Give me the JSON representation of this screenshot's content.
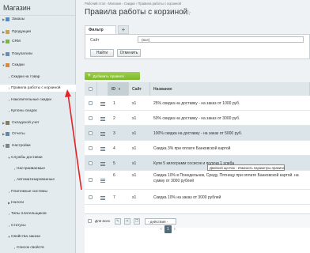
{
  "sidebar": {
    "title": "Магазин",
    "items": [
      {
        "label": "Заказы",
        "arrow": "▶",
        "icon_color": "#4f8bc9",
        "active": false
      },
      {
        "label": "Продукция",
        "arrow": "▶",
        "icon_color": "#c9a24f",
        "active": false
      },
      {
        "label": "CRM",
        "arrow": "▶",
        "icon_color": "#7ab34a",
        "active": false
      },
      {
        "label": "Покупатели",
        "arrow": "▶",
        "icon_color": "#6a8bb5",
        "active": false
      },
      {
        "label": "Скидки",
        "arrow": "▼",
        "icon_color": "#d58a3c",
        "active": false
      },
      {
        "label": "Скидки на товар",
        "arrow": "",
        "icon_color": "",
        "active": false
      },
      {
        "label": "Правила работы с корзиной",
        "arrow": "",
        "icon_color": "",
        "active": true
      },
      {
        "label": "Накопительные скидки",
        "arrow": "",
        "icon_color": "",
        "active": false
      },
      {
        "label": "Купоны скидок",
        "arrow": "",
        "icon_color": "",
        "active": false
      },
      {
        "label": "Складской учет",
        "arrow": "▶",
        "icon_color": "#8a7a5a",
        "active": false
      },
      {
        "label": "Отчеты",
        "arrow": "▶",
        "icon_color": "#5a8ab5",
        "active": false
      },
      {
        "label": "Настройки",
        "arrow": "▼",
        "icon_color": "#7a868c",
        "active": false
      },
      {
        "label": "Службы доставки",
        "arrow": "▼",
        "icon_color": "",
        "active": false
      },
      {
        "label": "Настраиваемые",
        "arrow": "",
        "icon_color": "",
        "active": false
      },
      {
        "label": "Автоматизированные",
        "arrow": "",
        "icon_color": "",
        "active": false
      },
      {
        "label": "Платежные системы",
        "arrow": "",
        "icon_color": "",
        "active": false
      },
      {
        "label": "Налоги",
        "arrow": "▶",
        "icon_color": "",
        "active": false
      },
      {
        "label": "Типы плательщиков",
        "arrow": "",
        "icon_color": "",
        "active": false
      },
      {
        "label": "Статусы",
        "arrow": "",
        "icon_color": "",
        "active": false
      },
      {
        "label": "Свойства заказа",
        "arrow": "▼",
        "icon_color": "",
        "active": false
      },
      {
        "label": "Список свойств",
        "arrow": "",
        "icon_color": "",
        "active": false
      }
    ]
  },
  "breadcrumbs": "Рабочий стол  ›  Магазин  ›  Скидки  ›  Правила работы с корзиной",
  "page_title": "Правила работы с корзиной",
  "star": "☆",
  "filter": {
    "tab_label": "Фильтр",
    "add_tab": "+",
    "site_label": "Сайт",
    "site_value": "(все)",
    "find_button": "Найти",
    "cancel_button": "Отменить"
  },
  "add_button": "Добавить правило",
  "table": {
    "headers": {
      "id": "ID",
      "site": "Сайт",
      "name": "Название"
    },
    "rows": [
      {
        "id": "1",
        "site": "s1",
        "name": "25% скидка на доставку - на заказ от 1000 руб.",
        "name2": ""
      },
      {
        "id": "2",
        "site": "s1",
        "name": "50% скидка на доставку - на заказ от 3000 руб.",
        "name2": ""
      },
      {
        "id": "3",
        "site": "s1",
        "name": "100% скидка на доставку - на заказ от 5000 руб.",
        "name2": ""
      },
      {
        "id": "4",
        "site": "s1",
        "name": "Скидка 3% при оплате Банковской картой",
        "name2": ""
      },
      {
        "id": "5",
        "site": "s1",
        "name": "Купи 5 килограмм сосисок и получи 1 хлеба",
        "name2": ""
      },
      {
        "id": "6",
        "site": "s1",
        "name": "Скидка 10% в Понедельник, Среду, Пятницу при оплате Банковской картой. на",
        "name2": "сумму от 3000 рублей"
      },
      {
        "id": "7",
        "site": "s1",
        "name": "Скидка 10% на заказ от 3000 рублей",
        "name2": ""
      }
    ],
    "tooltip": "Двойной щелчок - Изменить параметры правила",
    "footer": {
      "all_label": "Для всех",
      "actions_label": "- действия -",
      "page_current": "1"
    }
  },
  "colors": {
    "accent_green": "#7cb82a",
    "annotation_red": "#e0242a"
  }
}
